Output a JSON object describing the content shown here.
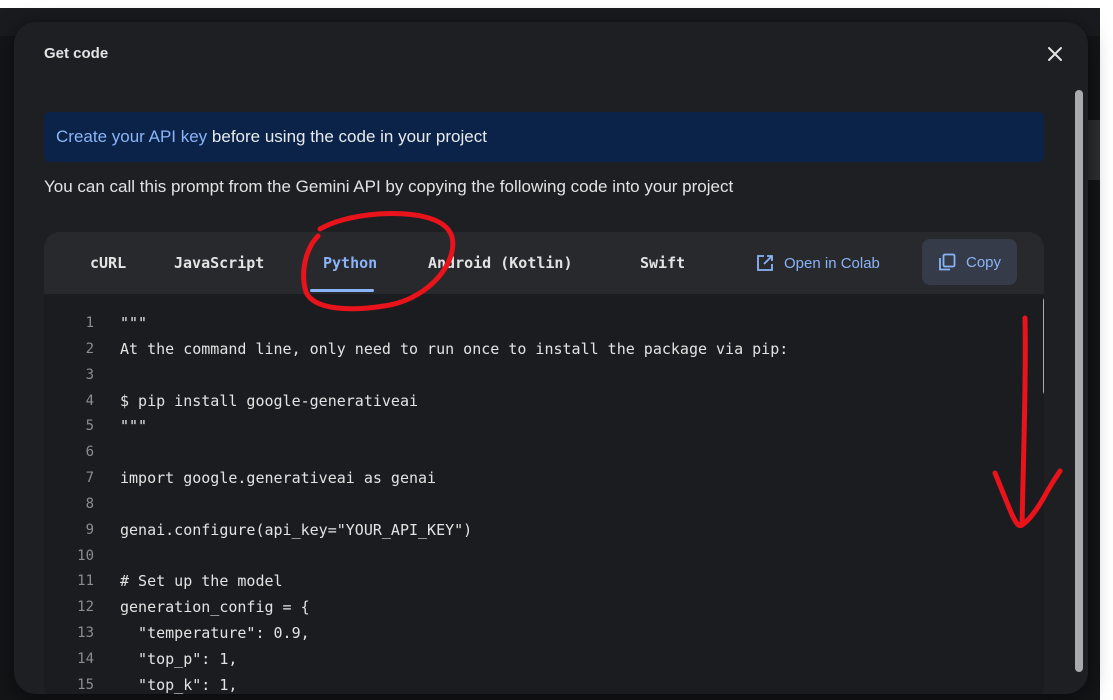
{
  "dialog": {
    "title": "Get code",
    "close_icon": "close-icon"
  },
  "banner": {
    "link_text": "Create your API key",
    "rest_text": " before using the code in your project"
  },
  "description": "You can call this prompt from the Gemini API by copying the following code into your project",
  "tabs": [
    {
      "label": "cURL",
      "active": false
    },
    {
      "label": "JavaScript",
      "active": false
    },
    {
      "label": "Python",
      "active": true
    },
    {
      "label": "Android (Kotlin)",
      "active": false
    },
    {
      "label": "Swift",
      "active": false
    }
  ],
  "actions": {
    "colab_label": "Open in Colab",
    "colab_icon": "open-external-icon",
    "copy_label": "Copy",
    "copy_icon": "copy-icon"
  },
  "code": [
    {
      "n": "1",
      "text": "\"\"\""
    },
    {
      "n": "2",
      "text": "At the command line, only need to run once to install the package via pip:"
    },
    {
      "n": "3",
      "text": ""
    },
    {
      "n": "4",
      "text": "$ pip install google-generativeai"
    },
    {
      "n": "5",
      "text": "\"\"\""
    },
    {
      "n": "6",
      "text": ""
    },
    {
      "n": "7",
      "text": "import google.generativeai as genai"
    },
    {
      "n": "8",
      "text": ""
    },
    {
      "n": "9",
      "text": "genai.configure(api_key=\"YOUR_API_KEY\")"
    },
    {
      "n": "10",
      "text": ""
    },
    {
      "n": "11",
      "text": "# Set up the model"
    },
    {
      "n": "12",
      "text": "generation_config = {"
    },
    {
      "n": "13",
      "text": "  \"temperature\": 0.9,"
    },
    {
      "n": "14",
      "text": "  \"top_p\": 1,"
    },
    {
      "n": "15",
      "text": "  \"top_k\": 1,"
    }
  ],
  "colors": {
    "accent": "#8ab4f8",
    "annotation": "#e8131b",
    "dialog_bg": "#1e1f22",
    "banner_bg": "#0b2348"
  }
}
